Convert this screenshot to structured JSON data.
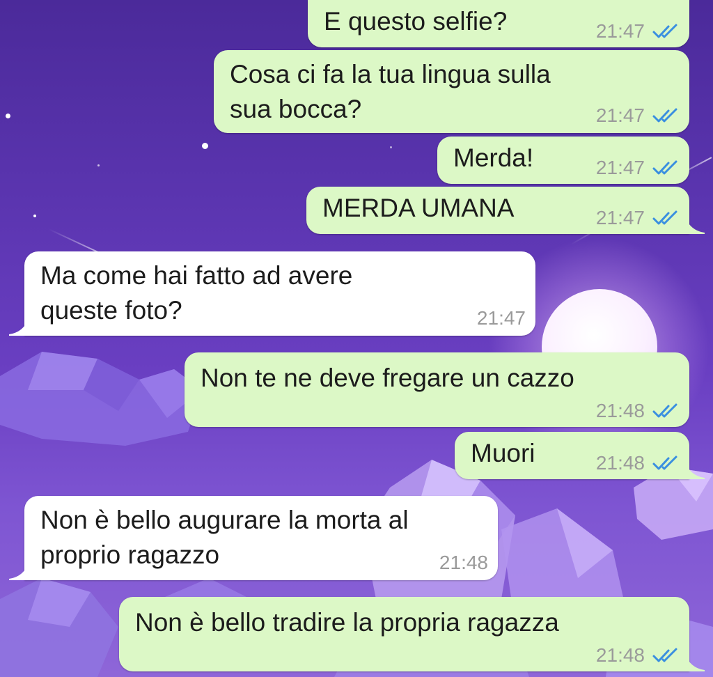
{
  "messages": [
    {
      "direction": "out",
      "text": "E questo selfie?",
      "time": "21:47",
      "status_icon": "double-check-read-icon"
    },
    {
      "direction": "out",
      "text": "Cosa ci fa la tua lingua sulla\nsua bocca?",
      "time": "21:47",
      "status_icon": "double-check-read-icon"
    },
    {
      "direction": "out",
      "text": "Merda!",
      "time": "21:47",
      "status_icon": "double-check-read-icon"
    },
    {
      "direction": "out",
      "text": "MERDA UMANA",
      "time": "21:47",
      "status_icon": "double-check-read-icon"
    },
    {
      "direction": "in",
      "text": "Ma come hai fatto ad avere\nqueste foto?",
      "time": "21:47"
    },
    {
      "direction": "out",
      "text": "Non te ne deve fregare un cazzo",
      "time": "21:48",
      "status_icon": "double-check-read-icon"
    },
    {
      "direction": "out",
      "text": "Muori",
      "time": "21:48",
      "status_icon": "double-check-read-icon"
    },
    {
      "direction": "in",
      "text": "Non è bello augurare la morta al\nproprio ragazzo",
      "time": "21:48"
    },
    {
      "direction": "out",
      "text": "Non è bello tradire la propria ragazza",
      "time": "21:48",
      "status_icon": "double-check-read-icon"
    }
  ],
  "colors": {
    "outgoing_bubble": "#dcf8c6",
    "incoming_bubble": "#ffffff",
    "read_ticks": "#3a8fe0",
    "timestamp": "#9a9a9a"
  }
}
